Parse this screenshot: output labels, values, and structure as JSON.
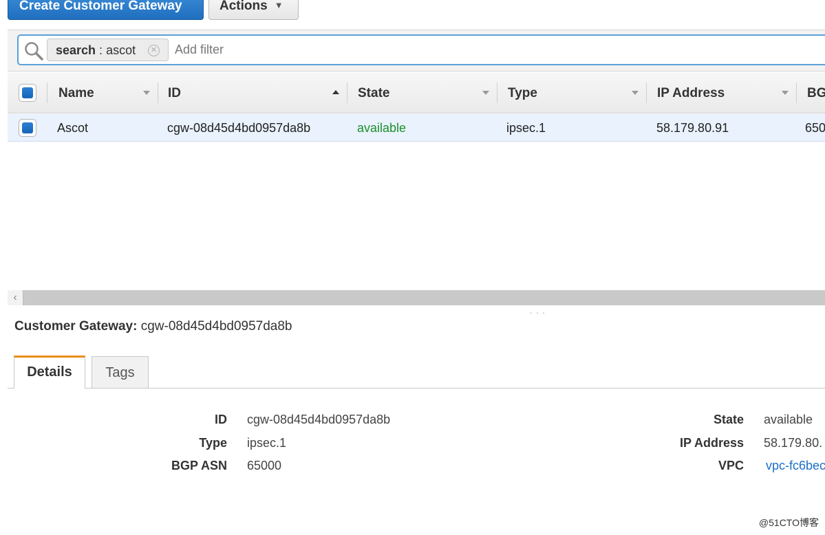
{
  "toolbar": {
    "create_label": "Create Customer Gateway",
    "actions_label": "Actions"
  },
  "filter": {
    "token_key": "search",
    "token_sep": " : ",
    "token_value": "ascot",
    "placeholder": "Add filter"
  },
  "table": {
    "headers": [
      "Name",
      "ID",
      "State",
      "Type",
      "IP Address",
      "BG"
    ],
    "rows": [
      {
        "name": "Ascot",
        "id": "cgw-08d45d4bd0957da8b",
        "state": "available",
        "type": "ipsec.1",
        "ip": "58.179.80.91",
        "bgp": "650"
      }
    ]
  },
  "detail": {
    "title_label": "Customer Gateway:",
    "title_value": "cgw-08d45d4bd0957da8b",
    "tabs": [
      "Details",
      "Tags"
    ],
    "left": [
      {
        "label": "ID",
        "value": "cgw-08d45d4bd0957da8b"
      },
      {
        "label": "Type",
        "value": "ipsec.1"
      },
      {
        "label": "BGP ASN",
        "value": "65000"
      }
    ],
    "right": [
      {
        "label": "State",
        "value": "available"
      },
      {
        "label": "IP Address",
        "value": "58.179.80."
      },
      {
        "label": "VPC",
        "value": "vpc-fc6bec"
      }
    ]
  },
  "watermark": "@51CTO博客",
  "colors": {
    "primary": "#1f6fbf",
    "available": "#1d8f2b",
    "link": "#1a6fc7",
    "tab_accent": "#e98c16"
  }
}
